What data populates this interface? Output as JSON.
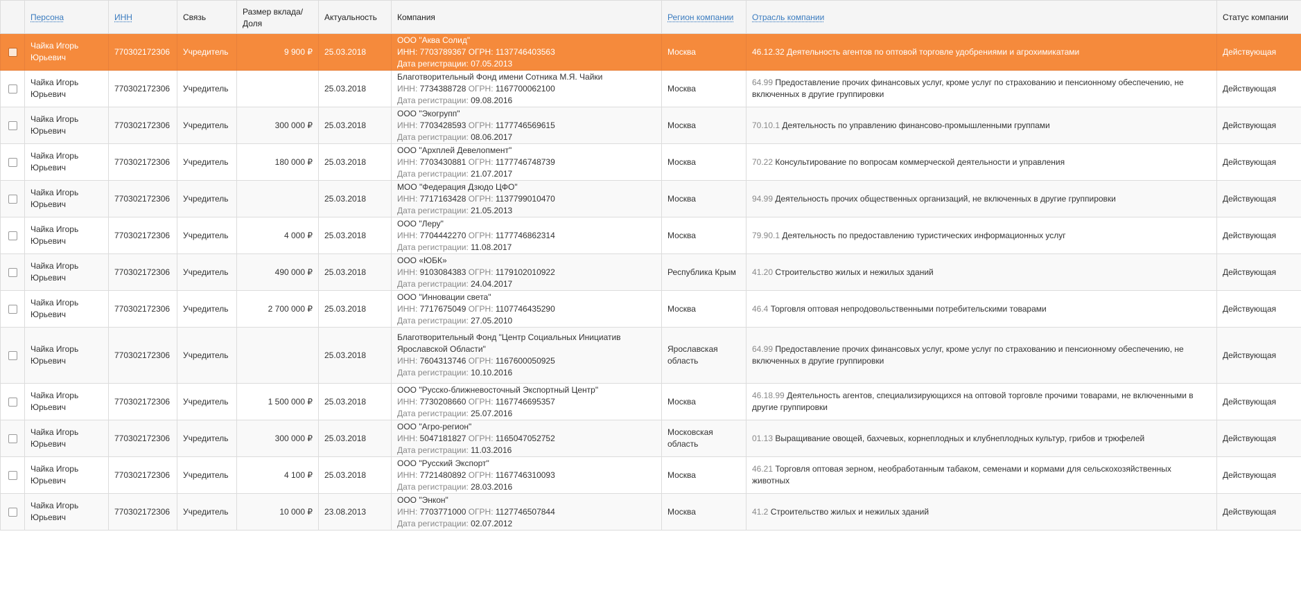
{
  "headers": {
    "person": "Персона",
    "inn": "ИНН",
    "link": "Связь",
    "deposit": "Размер вклада/ Доля",
    "actuality": "Актуальность",
    "company": "Компания",
    "region": "Регион компании",
    "industry": "Отрасль компании",
    "status": "Статус компании"
  },
  "labels": {
    "inn_prefix": "ИНН: ",
    "ogrn_prefix": " ОГРН: ",
    "reg_prefix": "Дата регистрации: "
  },
  "rows": [
    {
      "person": "Чайка Игорь Юрьевич",
      "inn": "770302172306",
      "link": "Учредитель",
      "deposit": "9 900 ₽",
      "actuality": "25.03.2018",
      "company_name": "ООО \"Аква Солид\"",
      "company_inn": "7703789367",
      "company_ogrn": "1137746403563",
      "company_reg": "07.05.2013",
      "region": "Москва",
      "industry_code": "46.12.32",
      "industry_text": "Деятельность агентов по оптовой торговле удобрениями и агрохимикатами",
      "status": "Действующая"
    },
    {
      "person": "Чайка Игорь Юрьевич",
      "inn": "770302172306",
      "link": "Учредитель",
      "deposit": "",
      "actuality": "25.03.2018",
      "company_name": "Благотворительный Фонд имени Сотника М.Я. Чайки",
      "company_inn": "7734388728",
      "company_ogrn": "1167700062100",
      "company_reg": "09.08.2016",
      "region": "Москва",
      "industry_code": "64.99",
      "industry_text": "Предоставление прочих финансовых услуг, кроме услуг по страхованию и пенсионному обеспечению, не включенных в другие группировки",
      "status": "Действующая"
    },
    {
      "person": "Чайка Игорь Юрьевич",
      "inn": "770302172306",
      "link": "Учредитель",
      "deposit": "300 000 ₽",
      "actuality": "25.03.2018",
      "company_name": "ООО \"Экогрупп\"",
      "company_inn": "7703428593",
      "company_ogrn": "1177746569615",
      "company_reg": "08.06.2017",
      "region": "Москва",
      "industry_code": "70.10.1",
      "industry_text": "Деятельность по управлению финансово-промышленными группами",
      "status": "Действующая"
    },
    {
      "person": "Чайка Игорь Юрьевич",
      "inn": "770302172306",
      "link": "Учредитель",
      "deposit": "180 000 ₽",
      "actuality": "25.03.2018",
      "company_name": "ООО \"Архплей Девелопмент\"",
      "company_inn": "7703430881",
      "company_ogrn": "1177746748739",
      "company_reg": "21.07.2017",
      "region": "Москва",
      "industry_code": "70.22",
      "industry_text": "Консультирование по вопросам коммерческой деятельности и управления",
      "status": "Действующая"
    },
    {
      "person": "Чайка Игорь Юрьевич",
      "inn": "770302172306",
      "link": "Учредитель",
      "deposit": "",
      "actuality": "25.03.2018",
      "company_name": "МОО \"Федерация Дзюдо ЦФО\"",
      "company_inn": "7717163428",
      "company_ogrn": "1137799010470",
      "company_reg": "21.05.2013",
      "region": "Москва",
      "industry_code": "94.99",
      "industry_text": "Деятельность прочих общественных организаций, не включенных в другие группировки",
      "status": "Действующая"
    },
    {
      "person": "Чайка Игорь Юрьевич",
      "inn": "770302172306",
      "link": "Учредитель",
      "deposit": "4 000 ₽",
      "actuality": "25.03.2018",
      "company_name": "ООО \"Леру\"",
      "company_inn": "7704442270",
      "company_ogrn": "1177746862314",
      "company_reg": "11.08.2017",
      "region": "Москва",
      "industry_code": "79.90.1",
      "industry_text": "Деятельность по предоставлению туристических информационных услуг",
      "status": "Действующая"
    },
    {
      "person": "Чайка Игорь Юрьевич",
      "inn": "770302172306",
      "link": "Учредитель",
      "deposit": "490 000 ₽",
      "actuality": "25.03.2018",
      "company_name": "ООО «ЮБК»",
      "company_inn": "9103084383",
      "company_ogrn": "1179102010922",
      "company_reg": "24.04.2017",
      "region": "Республика Крым",
      "industry_code": "41.20",
      "industry_text": "Строительство жилых и нежилых зданий",
      "status": "Действующая"
    },
    {
      "person": "Чайка Игорь Юрьевич",
      "inn": "770302172306",
      "link": "Учредитель",
      "deposit": "2 700 000 ₽",
      "actuality": "25.03.2018",
      "company_name": "ООО \"Инновации света\"",
      "company_inn": "7717675049",
      "company_ogrn": "1107746435290",
      "company_reg": "27.05.2010",
      "region": "Москва",
      "industry_code": "46.4",
      "industry_text": "Торговля оптовая непродовольственными потребительскими товарами",
      "status": "Действующая"
    },
    {
      "person": "Чайка Игорь Юрьевич",
      "inn": "770302172306",
      "link": "Учредитель",
      "deposit": "",
      "actuality": "25.03.2018",
      "company_name": "Благотворительный Фонд \"Центр Социальных Инициатив Ярославской Области\"",
      "company_inn": "7604313746",
      "company_ogrn": "1167600050925",
      "company_reg": "10.10.2016",
      "region": "Ярославская область",
      "industry_code": "64.99",
      "industry_text": "Предоставление прочих финансовых услуг, кроме услуг по страхованию и пенсионному обеспечению, не включенных в другие группировки",
      "status": "Действующая"
    },
    {
      "person": "Чайка Игорь Юрьевич",
      "inn": "770302172306",
      "link": "Учредитель",
      "deposit": "1 500 000 ₽",
      "actuality": "25.03.2018",
      "company_name": "ООО \"Русско-ближневосточный Экспортный Центр\"",
      "company_inn": "7730208660",
      "company_ogrn": "1167746695357",
      "company_reg": "25.07.2016",
      "region": "Москва",
      "industry_code": "46.18.99",
      "industry_text": "Деятельность агентов, специализирующихся на оптовой торговле прочими товарами, не включенными в другие группировки",
      "status": "Действующая"
    },
    {
      "person": "Чайка Игорь Юрьевич",
      "inn": "770302172306",
      "link": "Учредитель",
      "deposit": "300 000 ₽",
      "actuality": "25.03.2018",
      "company_name": "ООО \"Агро-регион\"",
      "company_inn": "5047181827",
      "company_ogrn": "1165047052752",
      "company_reg": "11.03.2016",
      "region": "Московская область",
      "industry_code": "01.13",
      "industry_text": "Выращивание овощей, бахчевых, корнеплодных и клубнеплодных культур, грибов и трюфелей",
      "status": "Действующая"
    },
    {
      "person": "Чайка Игорь Юрьевич",
      "inn": "770302172306",
      "link": "Учредитель",
      "deposit": "4 100 ₽",
      "actuality": "25.03.2018",
      "company_name": "ООО \"Русский Экспорт\"",
      "company_inn": "7721480892",
      "company_ogrn": "1167746310093",
      "company_reg": "28.03.2016",
      "region": "Москва",
      "industry_code": "46.21",
      "industry_text": "Торговля оптовая зерном, необработанным табаком, семенами и кормами для сельскохозяйственных животных",
      "status": "Действующая"
    },
    {
      "person": "Чайка Игорь Юрьевич",
      "inn": "770302172306",
      "link": "Учредитель",
      "deposit": "10 000 ₽",
      "actuality": "23.08.2013",
      "company_name": "ООО \"Энкон\"",
      "company_inn": "7703771000",
      "company_ogrn": "1127746507844",
      "company_reg": "02.07.2012",
      "region": "Москва",
      "industry_code": "41.2",
      "industry_text": "Строительство жилых и нежилых зданий",
      "status": "Действующая"
    }
  ]
}
